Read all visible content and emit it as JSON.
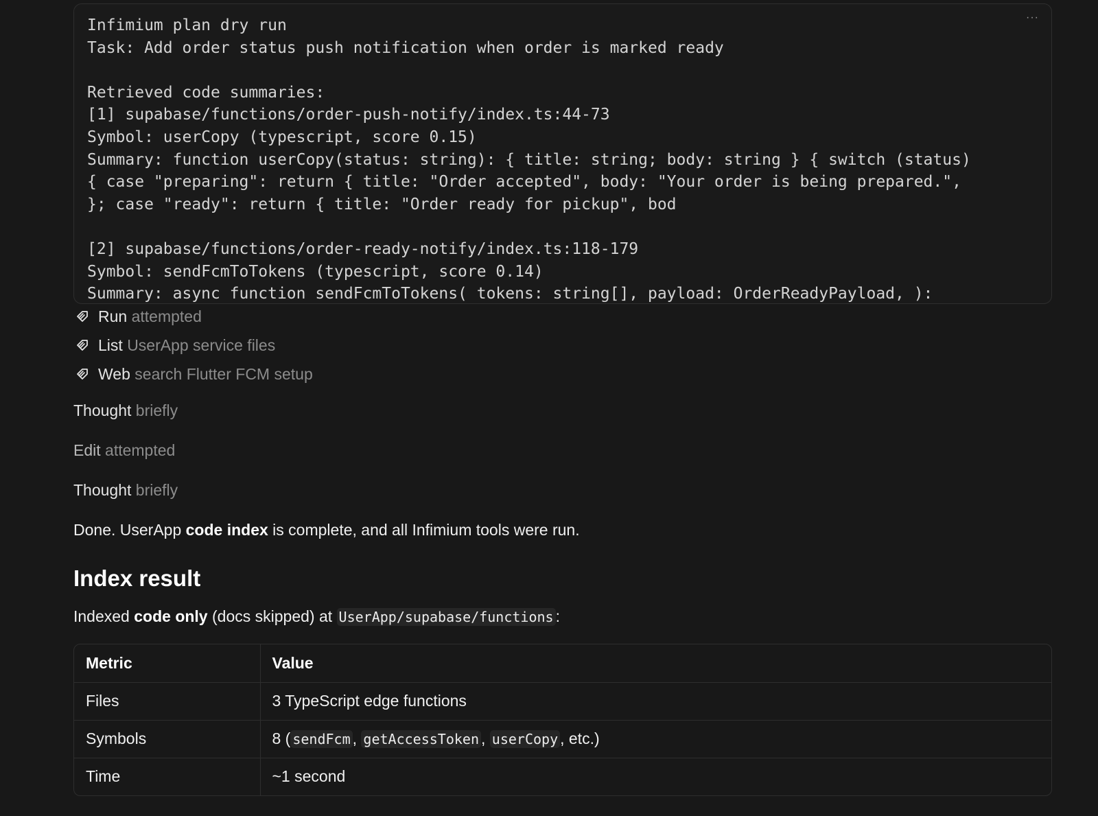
{
  "code_block": {
    "lines": [
      "Infimium plan dry run",
      "Task: Add order status push notification when order is marked ready",
      "",
      "Retrieved code summaries:",
      "[1] supabase/functions/order-push-notify/index.ts:44-73",
      "Symbol: userCopy (typescript, score 0.15)",
      "Summary: function userCopy(status: string): { title: string; body: string } { switch (status)",
      "{ case \"preparing\": return { title: \"Order accepted\", body: \"Your order is being prepared.\",",
      "}; case \"ready\": return { title: \"Order ready for pickup\", bod",
      "",
      "[2] supabase/functions/order-ready-notify/index.ts:118-179",
      "Symbol: sendFcmToTokens (typescript, score 0.14)",
      "Summary: async function sendFcmToTokens( tokens: string[], payload: OrderReadyPayload, ):"
    ],
    "menu_icon": "more-horizontal-icon",
    "menu_label": "···"
  },
  "steps": [
    {
      "verb": "Run",
      "detail": "attempted",
      "icon": "tool-icon"
    },
    {
      "verb": "List",
      "detail": "UserApp service files",
      "icon": "tool-icon"
    },
    {
      "verb": "Web",
      "detail": "search Flutter FCM setup",
      "icon": "tool-icon"
    }
  ],
  "thoughts": [
    {
      "verb": "Thought",
      "detail": "briefly"
    },
    {
      "verb": "Edit",
      "detail": "attempted"
    },
    {
      "verb": "Thought",
      "detail": "briefly"
    }
  ],
  "summary": {
    "prefix": "Done. UserApp ",
    "bold": "code index",
    "suffix": " is complete, and all Infimium tools were run."
  },
  "index_result": {
    "heading": "Index result",
    "line_prefix": "Indexed ",
    "line_bold": "code only",
    "line_middle": " (docs skipped) at ",
    "line_code": "UserApp/supabase/functions",
    "line_suffix": ":"
  },
  "table": {
    "headers": [
      "Metric",
      "Value"
    ],
    "rows": {
      "files": {
        "metric": "Files",
        "value": "3 TypeScript edge functions"
      },
      "symbols": {
        "metric": "Symbols",
        "value_prefix": "8 (",
        "code1": "sendFcm",
        "sep1": ", ",
        "code2": "getAccessToken",
        "sep2": ", ",
        "code3": "userCopy",
        "value_suffix": ", etc.)"
      },
      "time": {
        "metric": "Time",
        "value": "~1 second"
      }
    }
  }
}
